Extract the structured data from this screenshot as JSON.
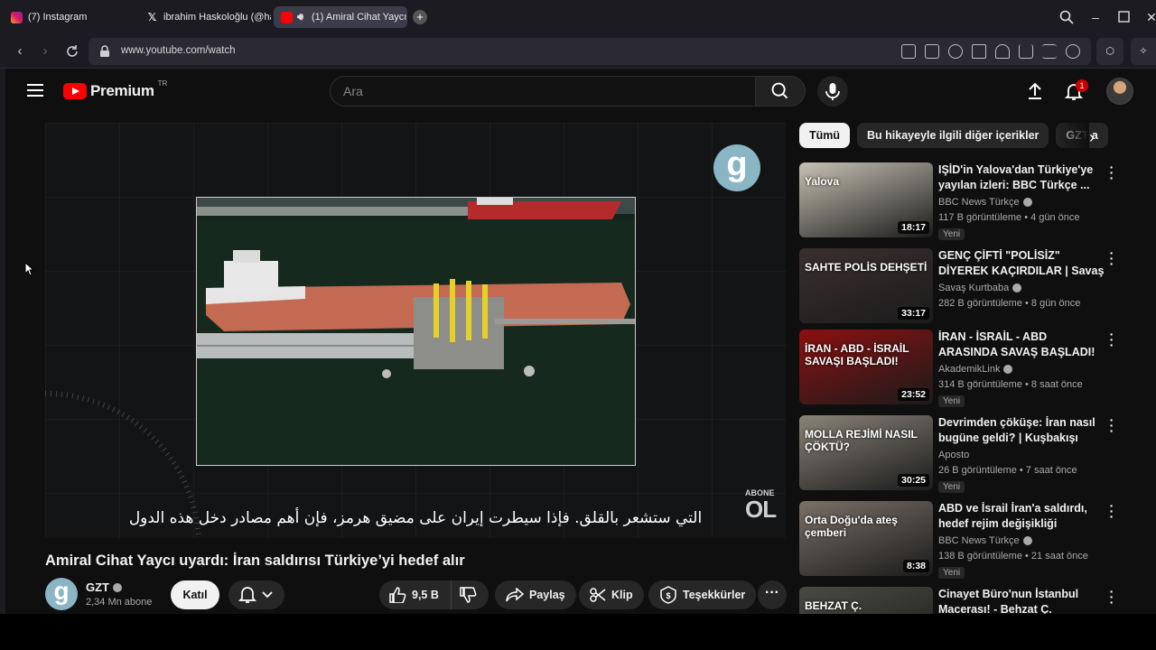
{
  "tabs": [
    {
      "label": "(7) Instagram",
      "icon": "instagram-icon"
    },
    {
      "label": "ibrahim Haskoloğlu (@has",
      "icon": "x-logo-icon"
    },
    {
      "label": "(1) Amiral Cihat Yaycı",
      "icon": "youtube-icon",
      "active": true
    }
  ],
  "address": {
    "url": "www.youtube.com/watch"
  },
  "youtube": {
    "logo_text": "Premium",
    "country_code": "TR",
    "search_placeholder": "Ara",
    "notification_count": "1"
  },
  "video": {
    "subtitle": "التي ستشعر بالقلق. فإذا سيطرت إيران على مضيق هرمز، فإن أهم مصادر دخل هذه الدول",
    "watermark_top": "ABONE",
    "watermark_bottom": "OL",
    "title": "Amiral Cihat Yaycı uyardı: İran saldırısı Türkiye’yi hedef alır",
    "channel": "GZT",
    "subscribers": "2,34 Mn abone",
    "join_label": "Katıl",
    "likes": "9,5 B",
    "share_label": "Paylaş",
    "clip_label": "Klip",
    "thanks_label": "Teşekkürler"
  },
  "chips": [
    "Tümü",
    "Bu hikayeyle ilgili diğer içerikler",
    "GZT a"
  ],
  "recommendations": [
    {
      "title": "IŞİD'in Yalova'dan Türkiye'ye yayılan izleri: BBC Türkçe ...",
      "channel": "BBC News Türkçe",
      "verified": true,
      "meta": "117 B görüntüleme • 4 gün önce",
      "badge": "Yeni",
      "duration": "18:17",
      "thumb_text": "Yalova",
      "thumb_color": "#c7c2b3"
    },
    {
      "title": "GENÇ ÇİFTİ \"POLİSİZ\" DİYEREK KAÇIRDILAR | Savaş Kurtbaba ...",
      "channel": "Savaş Kurtbaba",
      "verified": true,
      "meta": "282 B görüntüleme • 8 gün önce",
      "badge": "",
      "duration": "33:17",
      "thumb_text": "SAHTE POLİS DEHŞETİ",
      "thumb_color": "#3b2f2f"
    },
    {
      "title": "İRAN - İSRAİL - ABD ARASINDA SAVAŞ BAŞLADI!🔥 | Savaşı, ...",
      "channel": "AkademikLink",
      "verified": true,
      "meta": "314 B görüntüleme • 8 saat önce",
      "badge": "Yeni",
      "duration": "23:52",
      "thumb_text": "İRAN - ABD - İSRAİL SAVAŞI BAŞLADI!",
      "thumb_color": "#8c1010"
    },
    {
      "title": "Devrimden çöküşe: İran nasıl bugüne geldi? | Kuşbakışı",
      "channel": "Aposto",
      "verified": false,
      "meta": "26 B görüntüleme • 7 saat önce",
      "badge": "Yeni",
      "duration": "30:25",
      "thumb_text": "MOLLA REJİMİ NASIL ÇÖKTÜ?",
      "thumb_color": "#8a8378"
    },
    {
      "title": "ABD ve İsrail İran'a saldırdı, hedef rejim değişikliği",
      "channel": "BBC News Türkçe",
      "verified": true,
      "meta": "138 B görüntüleme • 21 saat önce",
      "badge": "Yeni",
      "duration": "8:38",
      "thumb_text": "Orta Doğu'da ateş çemberi",
      "thumb_color": "#7a7066"
    },
    {
      "title": "Cinayet Büro'nun İstanbul Macerası! - Behzat Ç.",
      "channel": "",
      "verified": false,
      "meta": "",
      "badge": "",
      "duration": "",
      "thumb_text": "BEHZAT Ç.",
      "thumb_color": "#4a4a44"
    }
  ]
}
